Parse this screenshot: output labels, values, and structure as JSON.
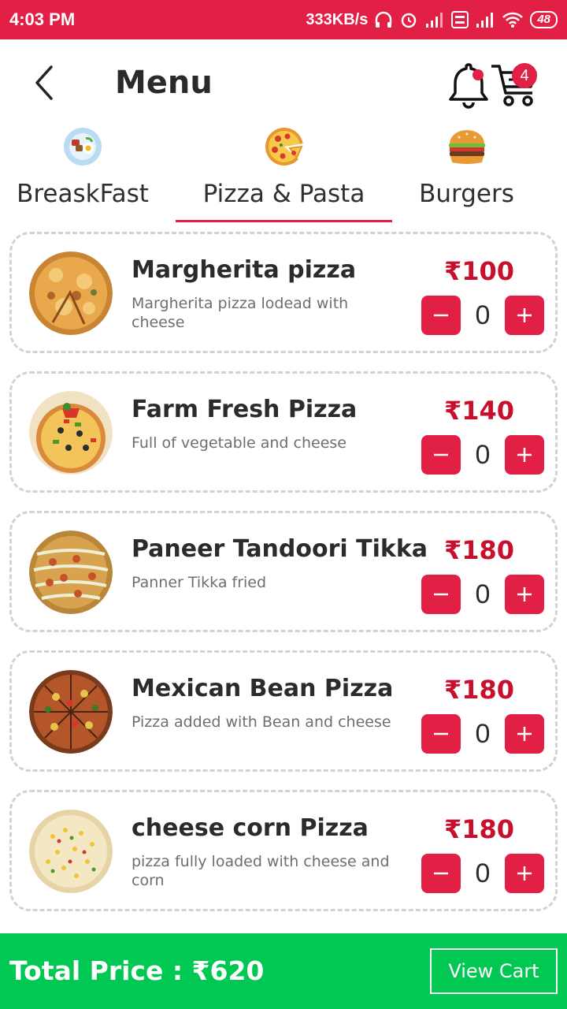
{
  "status_bar": {
    "time": "4:03 PM",
    "speed": "333KB/s",
    "battery": "48"
  },
  "header": {
    "title": "Menu",
    "cart_count": "4",
    "icons": {
      "back": "chevron-left-icon",
      "bell": "bell-icon",
      "cart": "cart-icon"
    }
  },
  "tabs": [
    {
      "label": "BreaskFast",
      "icon": "breakfast-plate-icon",
      "active": false
    },
    {
      "label": "Pizza & Pasta",
      "icon": "pizza-icon",
      "active": true
    },
    {
      "label": "Burgers",
      "icon": "burger-icon",
      "active": false
    }
  ],
  "items": [
    {
      "name": "Margherita pizza",
      "description": "Margherita pizza lodead with cheese",
      "price": "₹100",
      "quantity": "0"
    },
    {
      "name": "Farm Fresh Pizza",
      "description": "Full of vegetable and cheese",
      "price": "₹140",
      "quantity": "0"
    },
    {
      "name": "Paneer Tandoori Tikka",
      "description": "Panner Tikka fried",
      "price": "₹180",
      "quantity": "0"
    },
    {
      "name": "Mexican Bean Pizza",
      "description": "Pizza added with Bean and cheese",
      "price": "₹180",
      "quantity": "0"
    },
    {
      "name": "cheese corn Pizza",
      "description": "pizza fully loaded with cheese and corn",
      "price": "₹180",
      "quantity": "0"
    }
  ],
  "footer": {
    "total_label": "Total Price : ₹620",
    "view_cart_label": "View Cart"
  },
  "colors": {
    "primary": "#e21f45",
    "price": "#c8102e",
    "footer": "#00c853",
    "card_border": "#d2d2d2"
  }
}
